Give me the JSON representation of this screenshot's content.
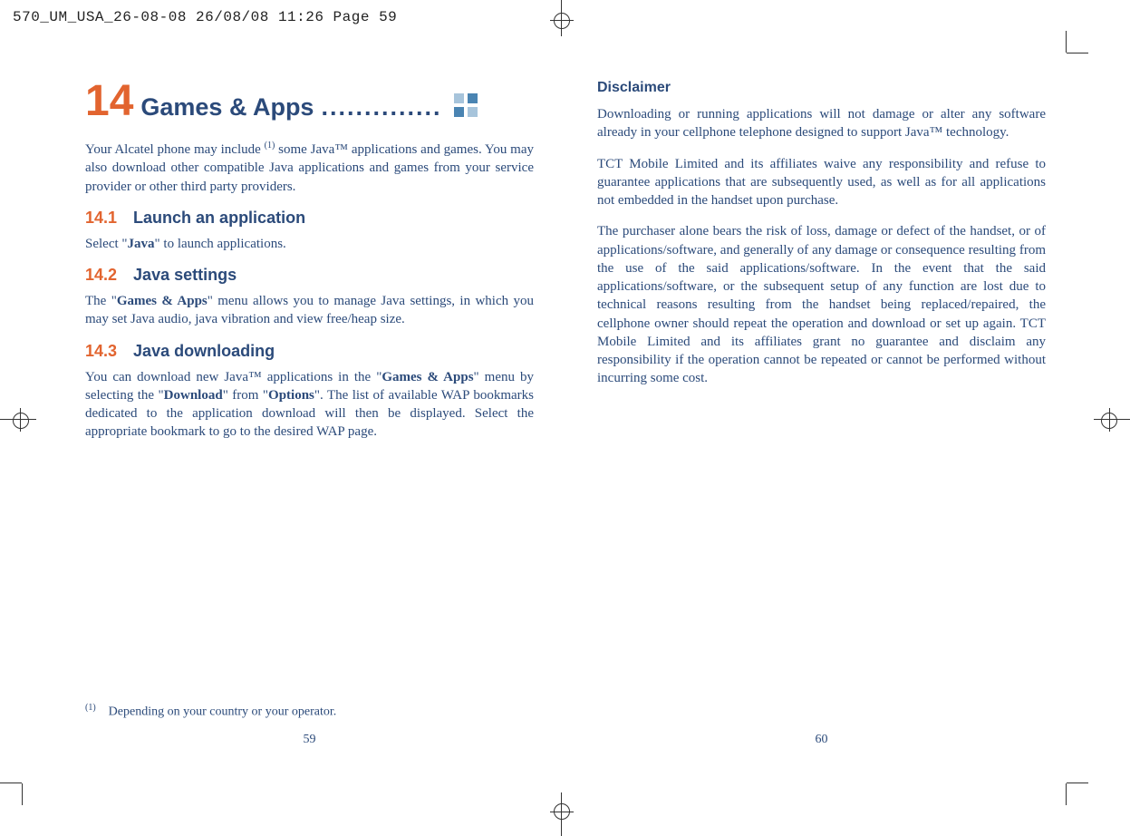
{
  "header": "570_UM_USA_26-08-08  26/08/08  11:26  Page 59",
  "chapter": {
    "number": "14",
    "title": "Games & Apps",
    "dots": "..............",
    "icon": "grid-apps-icon"
  },
  "left": {
    "intro_1": "Your Alcatel phone may include ",
    "intro_sup": "(1)",
    "intro_2": " some Java™ applications and games. You may also download other compatible Java applications and games from your service provider or other third party providers.",
    "sec1": {
      "num": "14.1",
      "title": "Launch an application",
      "p_pre": "Select \"",
      "p_bold": "Java",
      "p_post": "\" to launch applications."
    },
    "sec2": {
      "num": "14.2",
      "title": "Java settings",
      "p_pre": "The \"",
      "p_bold": "Games & Apps",
      "p_post": "\" menu allows you to manage Java settings, in which you may set Java audio, java vibration and view free/heap size."
    },
    "sec3": {
      "num": "14.3",
      "title": "Java downloading",
      "p_pre": "You can download new Java™ applications in the \"",
      "p_b1": "Games & Apps",
      "p_mid1": "\" menu by selecting the \"",
      "p_b2": "Download",
      "p_mid2": "\" from \"",
      "p_b3": "Options",
      "p_post": "\". The list of available WAP bookmarks dedicated to the application download will then be displayed. Select the appropriate bookmark to go to the desired WAP page."
    },
    "footnote_sup": "(1)",
    "footnote": "Depending on your country or your operator.",
    "page_number": "59"
  },
  "right": {
    "h": "Disclaimer",
    "p1": "Downloading or running applications will not damage or alter any software already in your cellphone telephone designed to support Java™ technology.",
    "p2": "TCT Mobile Limited and its affiliates waive any responsibility and refuse to guarantee applications that are subsequently used, as well as for all applications not embedded in the handset upon purchase.",
    "p3": "The purchaser alone bears the risk of loss, damage or defect of the handset, or of applications/software, and generally of any damage or consequence resulting from the use of the said applications/software. In the event that the said applications/software, or the subsequent setup of any function are lost due to technical reasons resulting from the handset being replaced/repaired, the cellphone owner should repeat the operation and download or set up again. TCT Mobile Limited and its affiliates grant no guarantee and disclaim any responsibility if the operation cannot be repeated or cannot be performed without incurring some cost.",
    "page_number": "60"
  }
}
